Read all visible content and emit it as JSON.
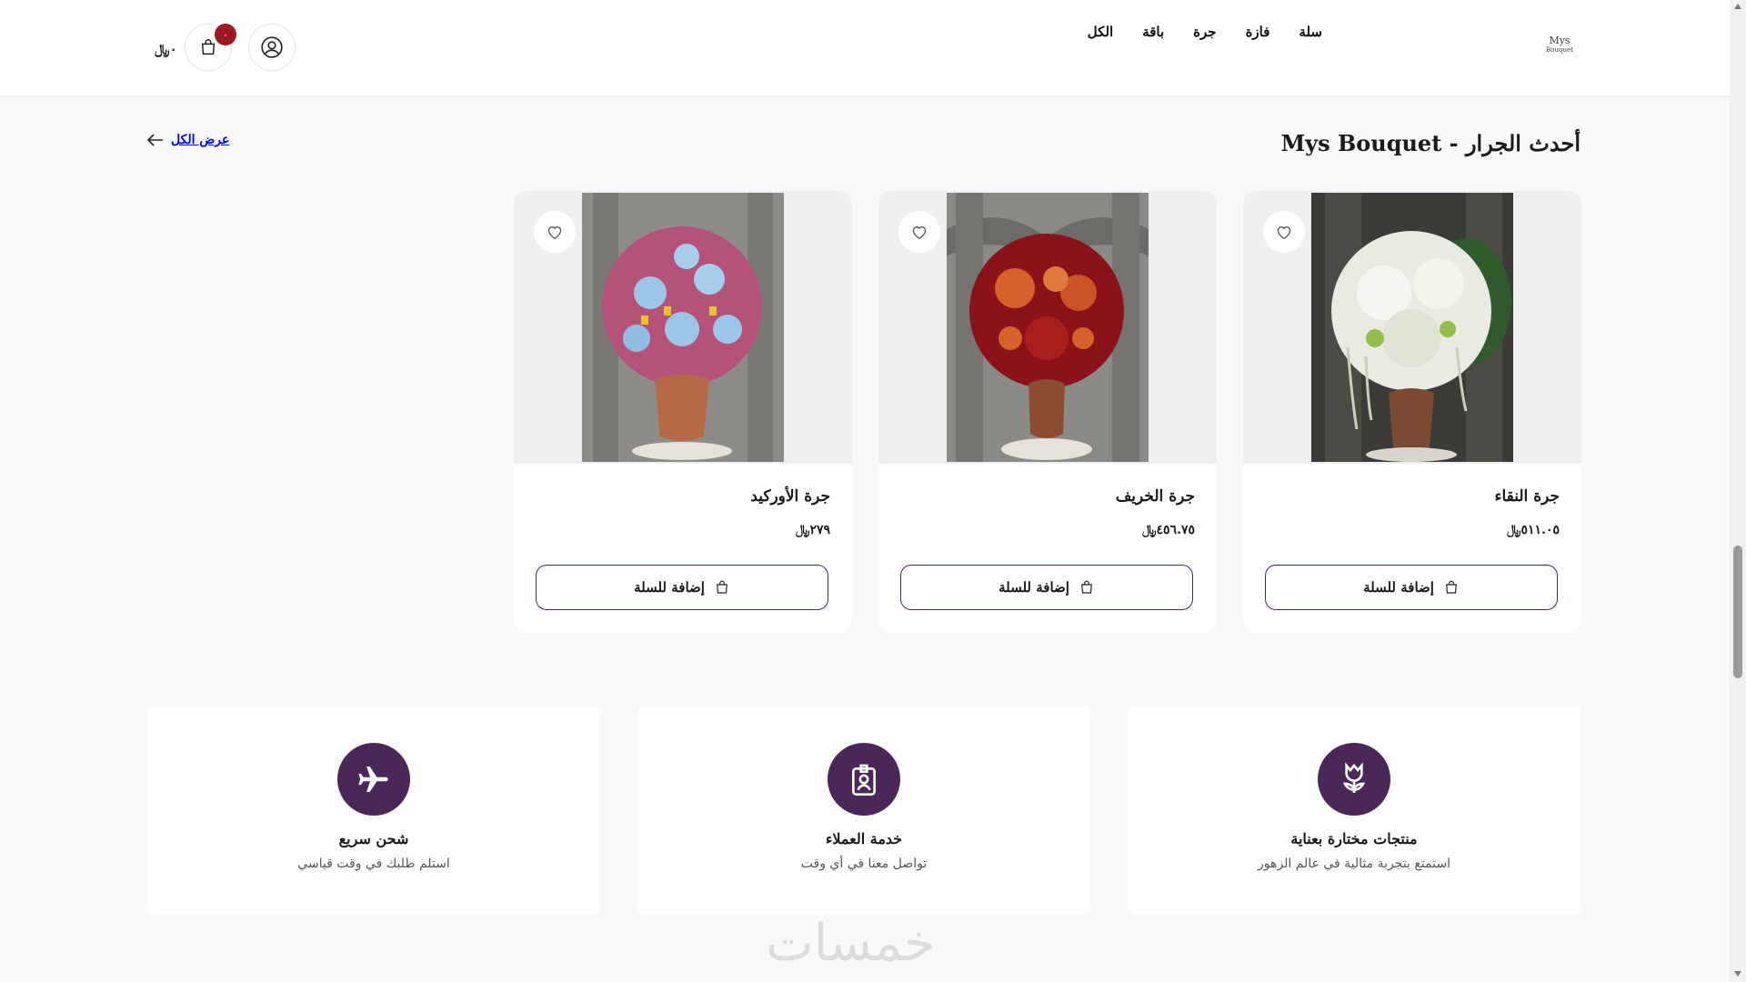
{
  "header": {
    "logo_line1": "Mys",
    "logo_line2": "Bouquet",
    "nav": [
      "الكل",
      "باقة",
      "جرة",
      "فازة",
      "سلة"
    ],
    "cart_total": "٠﷼",
    "cart_badge": "٠"
  },
  "section": {
    "title": "أحدث الجرار - Mys Bouquet",
    "view_all": "عرض الكل"
  },
  "products": [
    {
      "name": "جرة النقاء",
      "price": "٥١١.٠٥﷼",
      "button": "إضافة للسلة",
      "flower_colors": [
        "#f4f4ee",
        "#8fbf4a",
        "#e8eadf"
      ]
    },
    {
      "name": "جرة الخريف",
      "price": "٤٥٦.٧٥﷼",
      "button": "إضافة للسلة",
      "flower_colors": [
        "#8a1218",
        "#d4622a",
        "#a8201e"
      ]
    },
    {
      "name": "جرة الأوركيد",
      "price": "٢٧٩﷼",
      "button": "إضافة للسلة",
      "flower_colors": [
        "#b5527a",
        "#9bc6e8",
        "#e8c22a"
      ]
    }
  ],
  "features": [
    {
      "title": "منتجات مختارة بعناية",
      "subtitle": "استمتع بتجربة مثالية في عالم الزهور",
      "icon": "tulip-icon"
    },
    {
      "title": "خدمة العملاء",
      "subtitle": "تواصل معنا في أي وقت",
      "icon": "badge-person-icon"
    },
    {
      "title": "شحن سريع",
      "subtitle": "استلم طلبك في وقت قياسي",
      "icon": "airplane-icon"
    }
  ],
  "watermark": "خمسات",
  "colors": {
    "accent": "#4b2659",
    "badge": "#9c1a22",
    "background": "#f8f9fb"
  }
}
